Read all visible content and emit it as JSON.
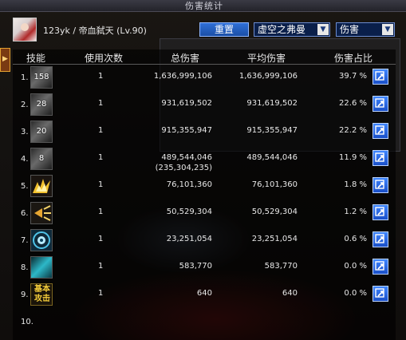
{
  "window": {
    "title": "伤害统计"
  },
  "player": {
    "name": "123yk / 帝血弑天 (Lv.90)"
  },
  "controls": {
    "reset_label": "重置",
    "target_value": "虚空之弗曼",
    "type_value": "伤害"
  },
  "table": {
    "headers": [
      "技能",
      "使用次数",
      "总伤害",
      "平均伤害",
      "伤害占比"
    ],
    "rows": [
      {
        "rank": "1.",
        "icon": "dark-skill-icon",
        "level": "158",
        "uses": "1",
        "total": "1,636,999,106",
        "total_extra": "",
        "avg": "1,636,999,106",
        "pct": "39.7 %"
      },
      {
        "rank": "2.",
        "icon": "dark-skill-icon",
        "level": "28",
        "uses": "1",
        "total": "931,619,502",
        "total_extra": "",
        "avg": "931,619,502",
        "pct": "22.6 %"
      },
      {
        "rank": "3.",
        "icon": "dark-skill-icon",
        "level": "20",
        "uses": "1",
        "total": "915,355,947",
        "total_extra": "",
        "avg": "915,355,947",
        "pct": "22.2 %"
      },
      {
        "rank": "4.",
        "icon": "dark-skill-icon",
        "level": "8",
        "uses": "1",
        "total": "489,544,046",
        "total_extra": "(235,304,235)",
        "avg": "489,544,046",
        "pct": "11.9 %"
      },
      {
        "rank": "5.",
        "icon": "lightning-skill-icon",
        "level": "",
        "uses": "1",
        "total": "76,101,360",
        "total_extra": "",
        "avg": "76,101,360",
        "pct": "1.8 %"
      },
      {
        "rank": "6.",
        "icon": "horn-skill-icon",
        "level": "",
        "uses": "1",
        "total": "50,529,304",
        "total_extra": "",
        "avg": "50,529,304",
        "pct": "1.2 %"
      },
      {
        "rank": "7.",
        "icon": "eye-skill-icon",
        "level": "",
        "uses": "1",
        "total": "23,251,054",
        "total_extra": "",
        "avg": "23,251,054",
        "pct": "0.6 %"
      },
      {
        "rank": "8.",
        "icon": "blue-skill-icon",
        "level": "",
        "uses": "1",
        "total": "583,770",
        "total_extra": "",
        "avg": "583,770",
        "pct": "0.0 %"
      },
      {
        "rank": "9.",
        "icon": "basic-attack-icon",
        "icon_text": "基本攻击",
        "level": "",
        "uses": "1",
        "total": "640",
        "total_extra": "",
        "avg": "640",
        "pct": "0.0 %"
      },
      {
        "rank": "10.",
        "icon": "",
        "level": "",
        "uses": "",
        "total": "",
        "total_extra": "",
        "avg": "",
        "pct": ""
      }
    ]
  },
  "colors": {
    "accent_blue": "#2f6fd6",
    "icon_gold": "#f4cc3a",
    "panel_dark": "#000000"
  }
}
